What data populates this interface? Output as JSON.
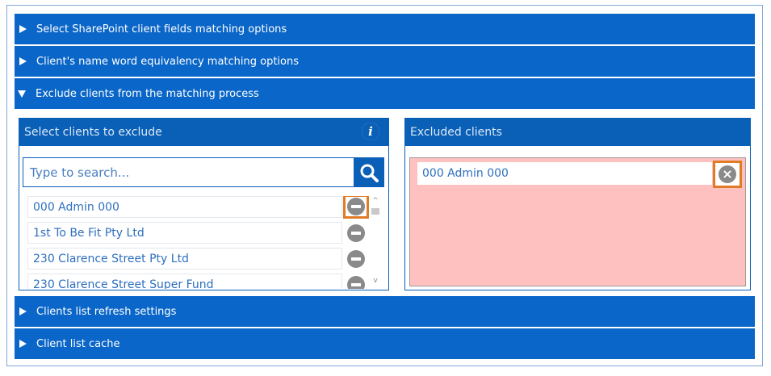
{
  "accordion": {
    "items": [
      {
        "label": "Select SharePoint client fields matching options",
        "expanded": false
      },
      {
        "label": "Client's name word equivalency matching options",
        "expanded": false
      },
      {
        "label": "Exclude clients from the matching process",
        "expanded": true
      },
      {
        "label": "Clients list refresh settings",
        "expanded": false
      },
      {
        "label": "Client list cache",
        "expanded": false
      }
    ]
  },
  "select_panel": {
    "title": "Select clients to exclude",
    "info_icon": "info-icon",
    "search": {
      "placeholder": "Type to search...",
      "value": ""
    },
    "clients": [
      {
        "name": "000 Admin 000"
      },
      {
        "name": "1st To Be Fit Pty Ltd"
      },
      {
        "name": "230 Clarence Street Pty Ltd"
      },
      {
        "name": "230 Clarence Street Super Fund"
      }
    ]
  },
  "excluded_panel": {
    "title": "Excluded clients",
    "clients": [
      {
        "name": "000 Admin 000"
      }
    ]
  },
  "colors": {
    "accent": "#0a66c8",
    "panel_header": "#0a5fb7",
    "excluded_bg": "#ffc0c0",
    "highlight": "#e07b28",
    "link_text": "#2e6fbf"
  }
}
